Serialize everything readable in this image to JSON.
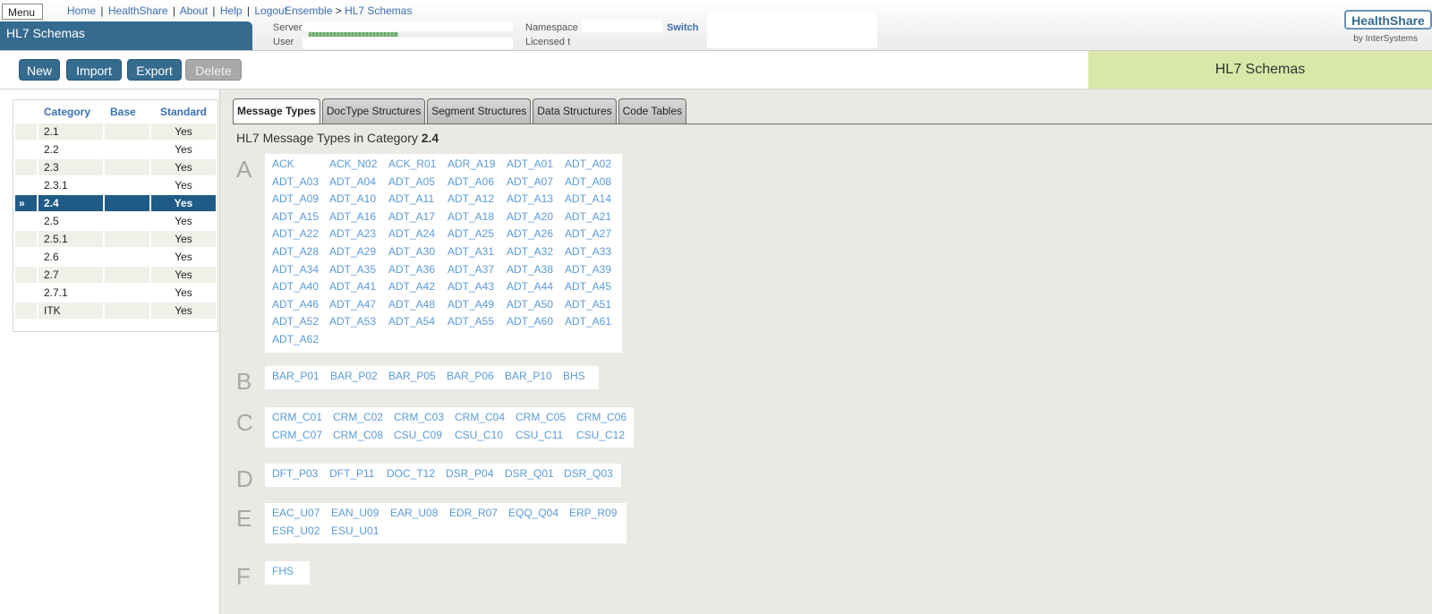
{
  "header": {
    "menu_label": "Menu",
    "links": [
      "Home",
      "HealthShare",
      "About",
      "Help",
      "Logout"
    ],
    "separator": "|",
    "breadcrumb": {
      "root": "Ensemble",
      "separator": ">",
      "current": "HL7 Schemas"
    },
    "app_title": "HL7 Schemas",
    "server_label": "Server",
    "user_label": "User",
    "namespace_label": "Namespace",
    "switch_label": "Switch",
    "licensed_label": "Licensed t",
    "logo_text": "HealthShare",
    "logo_sub": "by InterSystems"
  },
  "toolbar": {
    "buttons": [
      {
        "label": "New",
        "enabled": true
      },
      {
        "label": "Import",
        "enabled": true
      },
      {
        "label": "Export",
        "enabled": true
      },
      {
        "label": "Delete",
        "enabled": false
      }
    ],
    "page_label": "HL7 Schemas"
  },
  "categories": {
    "columns": [
      "Category",
      "Base",
      "Standard"
    ],
    "selected_marker": "»",
    "rows": [
      {
        "category": "2.1",
        "base": "",
        "standard": "Yes"
      },
      {
        "category": "2.2",
        "base": "",
        "standard": "Yes"
      },
      {
        "category": "2.3",
        "base": "",
        "standard": "Yes"
      },
      {
        "category": "2.3.1",
        "base": "",
        "standard": "Yes"
      },
      {
        "category": "2.4",
        "base": "",
        "standard": "Yes",
        "selected": true
      },
      {
        "category": "2.5",
        "base": "",
        "standard": "Yes"
      },
      {
        "category": "2.5.1",
        "base": "",
        "standard": "Yes"
      },
      {
        "category": "2.6",
        "base": "",
        "standard": "Yes"
      },
      {
        "category": "2.7",
        "base": "",
        "standard": "Yes"
      },
      {
        "category": "2.7.1",
        "base": "",
        "standard": "Yes"
      },
      {
        "category": "ITK",
        "base": "",
        "standard": "Yes"
      }
    ]
  },
  "tabs": [
    {
      "label": "Message Types",
      "active": true
    },
    {
      "label": "DocType Structures"
    },
    {
      "label": "Segment Structures"
    },
    {
      "label": "Data Structures"
    },
    {
      "label": "Code Tables"
    }
  ],
  "content": {
    "heading_prefix": "HL7 Message Types in Category",
    "heading_value": "2.4",
    "groups": [
      {
        "letter": "A",
        "items": [
          "ACK",
          "ACK_N02",
          "ACK_R01",
          "ADR_A19",
          "ADT_A01",
          "ADT_A02",
          "ADT_A03",
          "ADT_A04",
          "ADT_A05",
          "ADT_A06",
          "ADT_A07",
          "ADT_A08",
          "ADT_A09",
          "ADT_A10",
          "ADT_A11",
          "ADT_A12",
          "ADT_A13",
          "ADT_A14",
          "ADT_A15",
          "ADT_A16",
          "ADT_A17",
          "ADT_A18",
          "ADT_A20",
          "ADT_A21",
          "ADT_A22",
          "ADT_A23",
          "ADT_A24",
          "ADT_A25",
          "ADT_A26",
          "ADT_A27",
          "ADT_A28",
          "ADT_A29",
          "ADT_A30",
          "ADT_A31",
          "ADT_A32",
          "ADT_A33",
          "ADT_A34",
          "ADT_A35",
          "ADT_A36",
          "ADT_A37",
          "ADT_A38",
          "ADT_A39",
          "ADT_A40",
          "ADT_A41",
          "ADT_A42",
          "ADT_A43",
          "ADT_A44",
          "ADT_A45",
          "ADT_A46",
          "ADT_A47",
          "ADT_A48",
          "ADT_A49",
          "ADT_A50",
          "ADT_A51",
          "ADT_A52",
          "ADT_A53",
          "ADT_A54",
          "ADT_A55",
          "ADT_A60",
          "ADT_A61",
          "ADT_A62"
        ]
      },
      {
        "letter": "B",
        "items": [
          "BAR_P01",
          "BAR_P02",
          "BAR_P05",
          "BAR_P06",
          "BAR_P10",
          "BHS"
        ]
      },
      {
        "letter": "C",
        "items": [
          "CRM_C01",
          "CRM_C02",
          "CRM_C03",
          "CRM_C04",
          "CRM_C05",
          "CRM_C06",
          "CRM_C07",
          "CRM_C08",
          "CSU_C09",
          "CSU_C10",
          "CSU_C11",
          "CSU_C12"
        ]
      },
      {
        "letter": "D",
        "items": [
          "DFT_P03",
          "DFT_P11",
          "DOC_T12",
          "DSR_P04",
          "DSR_Q01",
          "DSR_Q03"
        ]
      },
      {
        "letter": "E",
        "items": [
          "EAC_U07",
          "EAN_U09",
          "EAR_U08",
          "EDR_R07",
          "EQQ_Q04",
          "ERP_R09",
          "ESR_U02",
          "ESU_U01"
        ]
      },
      {
        "letter": "F",
        "items": [
          "FHS"
        ]
      }
    ]
  }
}
